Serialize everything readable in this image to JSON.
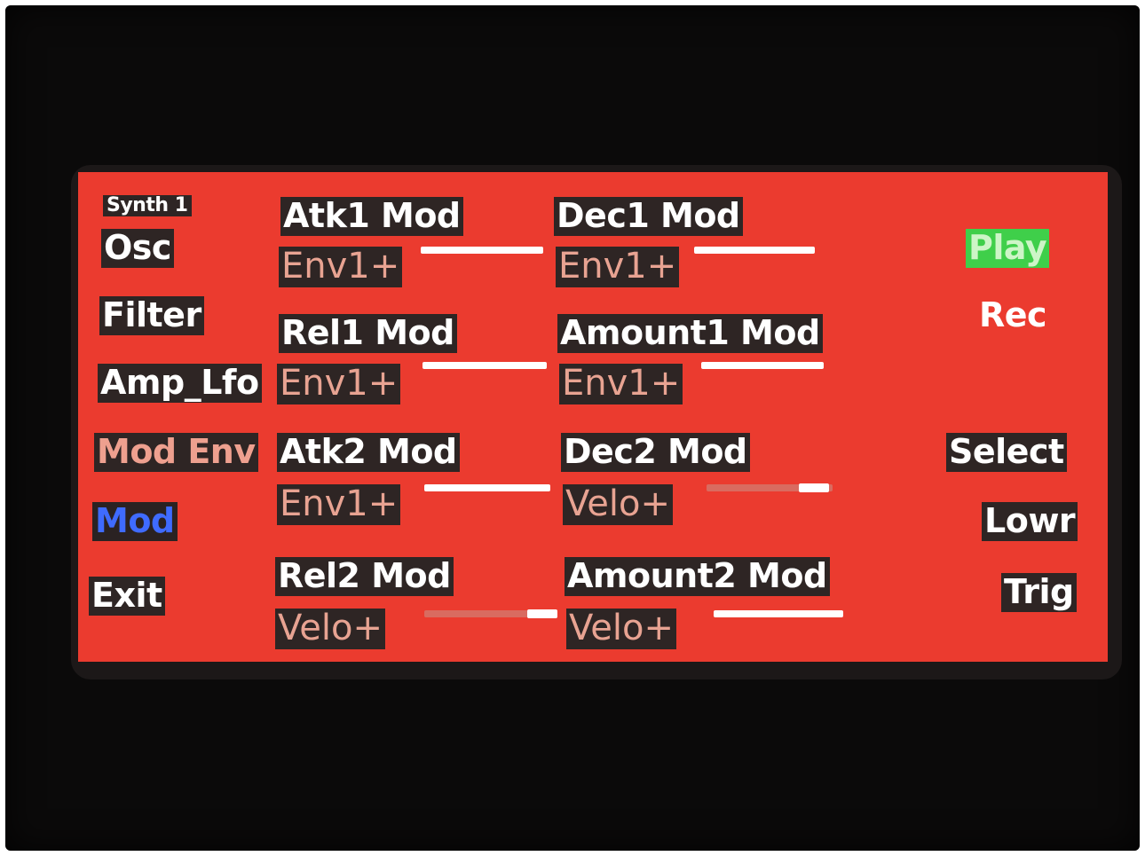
{
  "synth_label": "Synth 1",
  "left_menu": {
    "osc": "Osc",
    "filter": "Filter",
    "amp_lfo": "Amp_Lfo",
    "mod_env": "Mod Env",
    "mod": "Mod",
    "exit": "Exit"
  },
  "right_menu": {
    "play": "Play",
    "rec": "Rec",
    "select": "Select",
    "lowr": "Lowr",
    "trig": "Trig"
  },
  "params": {
    "atk1": {
      "name": "Atk1 Mod",
      "value": "Env1+",
      "level": 1.0
    },
    "dec1": {
      "name": "Dec1 Mod",
      "value": "Env1+",
      "level": 1.0
    },
    "rel1": {
      "name": "Rel1 Mod",
      "value": "Env1+",
      "level": 1.0
    },
    "amount1": {
      "name": "Amount1 Mod",
      "value": "Env1+",
      "level": 1.0
    },
    "atk2": {
      "name": "Atk2 Mod",
      "value": "Env1+",
      "level": 1.0
    },
    "dec2": {
      "name": "Dec2 Mod",
      "value": "Velo+",
      "level": 0.85
    },
    "rel2": {
      "name": "Rel2 Mod",
      "value": "Velo+",
      "level": 0.85
    },
    "amount2": {
      "name": "Amount2 Mod",
      "value": "Velo+",
      "level": 1.0
    }
  },
  "colors": {
    "screen": "#eb3b2f",
    "label_bg": "#2e2524",
    "active_tab": "#3f6bff",
    "play": "#3fcf4a"
  }
}
